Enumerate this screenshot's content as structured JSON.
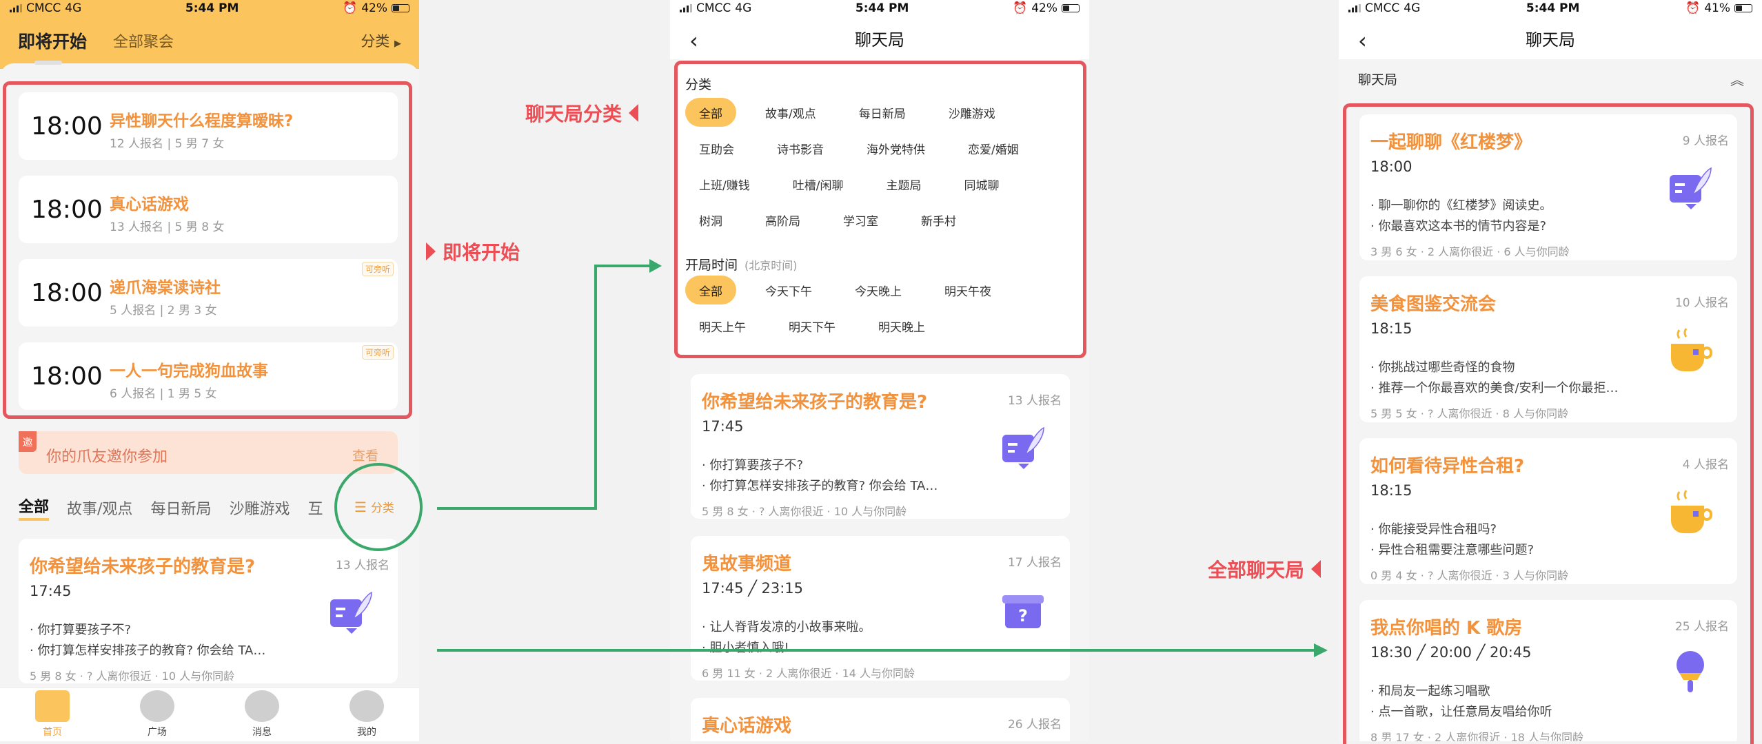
{
  "status": {
    "carrier": "CMCC",
    "net": "4G",
    "time": "5:44 PM",
    "battery1": "42%",
    "battery2": "42%",
    "battery3": "41%"
  },
  "screen1": {
    "tabs": [
      "即将开始",
      "全部聚会"
    ],
    "filter": "分类",
    "upcoming": [
      {
        "time": "18:00",
        "title": "异性聊天什么程度算暧昧?",
        "stats": "12 人报名  |   5 男 7 女",
        "tag": ""
      },
      {
        "time": "18:00",
        "title": "真心话游戏",
        "stats": "13 人报名  |   5 男 8 女",
        "tag": ""
      },
      {
        "time": "18:00",
        "title": "递爪海棠读诗社",
        "stats": "5 人报名  |   2 男 3 女",
        "tag": "可旁听"
      },
      {
        "time": "18:00",
        "title": "一人一句完成狗血故事",
        "stats": "6 人报名  |   1 男 5 女",
        "tag": "可旁听"
      }
    ],
    "invite": {
      "badge": "邀",
      "text": "你的爪友邀你参加",
      "link": "查看"
    },
    "cats": [
      "全部",
      "故事/观点",
      "每日新局",
      "沙雕游戏",
      "互"
    ],
    "cat_button": "分类",
    "game": {
      "title": "你希望给未来孩子的教育是?",
      "count": "13 人报名",
      "time": "17:45",
      "desc1": "· 你打算要孩子不?",
      "desc2": "· 你打算怎样安排孩子的教育? 你会给 TA…",
      "foot": "5 男 8 女 · ? 人离你很近 · 10 人与你同龄"
    },
    "tabbar": [
      "首页",
      "广场",
      "消息",
      "我的"
    ]
  },
  "screen2": {
    "title": "聊天局",
    "cat_heading": "分类",
    "categories": [
      "全部",
      "故事/观点",
      "每日新局",
      "沙雕游戏",
      "互助会",
      "诗书影音",
      "海外党特供",
      "恋爱/婚姻",
      "上班/赚钱",
      "吐槽/闲聊",
      "主题局",
      "同城聊",
      "树洞",
      "高阶局",
      "学习室",
      "新手村"
    ],
    "time_heading": "开局时间",
    "time_note": "(北京时间)",
    "times": [
      "全部",
      "今天下午",
      "今天晚上",
      "明天午夜",
      "明天上午",
      "明天下午",
      "明天晚上"
    ],
    "games": [
      {
        "title": "你希望给未来孩子的教育是?",
        "count": "13 人报名",
        "time": "17:45",
        "desc1": "· 你打算要孩子不?",
        "desc2": "· 你打算怎样安排孩子的教育? 你会给 TA…",
        "foot": "5 男 8 女 · ? 人离你很近 · 10 人与你同龄"
      },
      {
        "title": "鬼故事频道",
        "count": "17 人报名",
        "time": "17:45 ╱ 23:15",
        "desc1": "· 让人脊背发凉的小故事来啦。",
        "desc2": "· 胆小者慎入哦!",
        "foot": "6 男 11 女 · 2 人离你很近 · 14 人与你同龄"
      },
      {
        "title": "真心话游戏",
        "count": "26 人报名",
        "time": "",
        "desc1": "",
        "desc2": "",
        "foot": ""
      }
    ]
  },
  "screen3": {
    "title": "聊天局",
    "bar": "聊天局",
    "games": [
      {
        "title": "一起聊聊《红楼梦》",
        "count": "9 人报名",
        "time": "18:00",
        "desc1": "· 聊一聊你的《红楼梦》阅读史。",
        "desc2": "· 你最喜欢这本书的情节内容是?",
        "foot": "3 男 6 女 · 2 人离你很近 · 6 人与你同龄"
      },
      {
        "title": "美食图鉴交流会",
        "count": "10 人报名",
        "time": "18:15",
        "desc1": "· 你挑战过哪些奇怪的食物",
        "desc2": "· 推荐一个你最喜欢的美食/安利一个你最拒…",
        "foot": "5 男 5 女 · ? 人离你很近 · 8 人与你同龄"
      },
      {
        "title": "如何看待异性合租?",
        "count": "4 人报名",
        "time": "18:15",
        "desc1": "· 你能接受异性合租吗?",
        "desc2": "· 异性合租需要注意哪些问题?",
        "foot": "0 男 4 女 · ? 人离你很近 · 3 人与你同龄"
      },
      {
        "title": "我点你唱的 K 歌房",
        "count": "25 人报名",
        "time": "18:30 ╱ 20:00 ╱ 20:45",
        "desc1": "· 和局友一起练习唱歌",
        "desc2": "· 点一首歌，让任意局友唱给你听",
        "foot": "8 男 17 女 · 2 人离你很近 · 18 人与你同龄"
      }
    ]
  },
  "annotations": {
    "label1": "即将开始",
    "label2": "聊天局分类",
    "label3": "全部聊天局"
  },
  "colors": {
    "accent": "#fcc45c",
    "title_orange": "#f2923c",
    "annot_red": "#e4575e",
    "arrow_green": "#3aa86a"
  }
}
